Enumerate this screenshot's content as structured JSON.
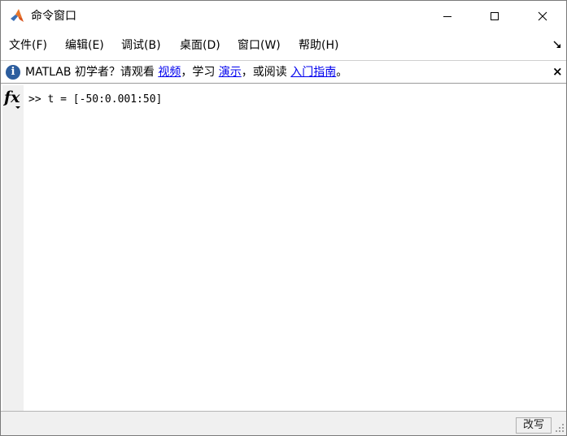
{
  "window": {
    "title": "命令窗口"
  },
  "menu": {
    "items": [
      {
        "label": "文件(F)"
      },
      {
        "label": "编辑(E)"
      },
      {
        "label": "调试(B)"
      },
      {
        "label": "桌面(D)"
      },
      {
        "label": "窗口(W)"
      },
      {
        "label": "帮助(H)"
      }
    ]
  },
  "infobar": {
    "prefix": "MATLAB 初学者？请观看 ",
    "link_video": "视频",
    "sep1": "，学习 ",
    "link_demo": "演示",
    "sep2": "，或阅读 ",
    "link_guide": "入门指南",
    "suffix": "。",
    "close_glyph": "×"
  },
  "command": {
    "fx_label": "fx",
    "line": ">> t = [-50:0.001:50]"
  },
  "status": {
    "mode": "改写"
  },
  "colors": {
    "link": "#0000ee",
    "info_icon": "#2c5d9e",
    "gutter": "#f0f0f0"
  }
}
